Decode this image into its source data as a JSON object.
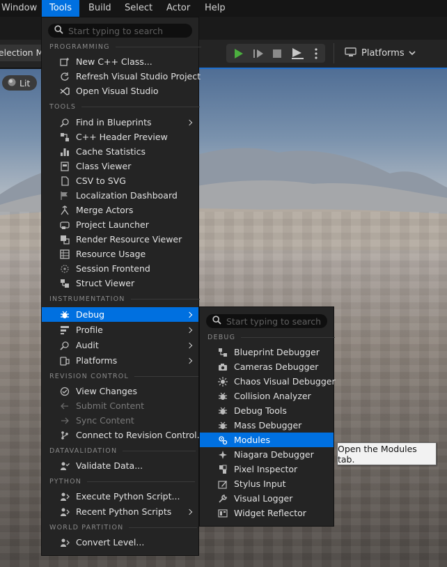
{
  "menubar": {
    "items": [
      {
        "label": "Window"
      },
      {
        "label": "Tools"
      },
      {
        "label": "Build"
      },
      {
        "label": "Select"
      },
      {
        "label": "Actor"
      },
      {
        "label": "Help"
      }
    ]
  },
  "toolbar": {
    "selection_mode": "Selection Mode",
    "platforms": "Platforms"
  },
  "viewport": {
    "lit": "Lit"
  },
  "tools_menu": {
    "search_placeholder": "Start typing to search",
    "sections": {
      "programming": "PROGRAMMING",
      "tools": "TOOLS",
      "instrumentation": "INSTRUMENTATION",
      "revision_control": "REVISION CONTROL",
      "datavalidation": "DATAVALIDATION",
      "python": "PYTHON",
      "world_partition": "WORLD PARTITION"
    },
    "items": {
      "new_cpp_class": "New C++ Class...",
      "refresh_vs": "Refresh Visual Studio Project",
      "open_vs": "Open Visual Studio",
      "find_in_blueprints": "Find in Blueprints",
      "cpp_header_preview": "C++ Header Preview",
      "cache_statistics": "Cache Statistics",
      "class_viewer": "Class Viewer",
      "csv_to_svg": "CSV to SVG",
      "localization_dashboard": "Localization Dashboard",
      "merge_actors": "Merge Actors",
      "project_launcher": "Project Launcher",
      "render_resource_viewer": "Render Resource Viewer",
      "resource_usage": "Resource Usage",
      "session_frontend": "Session Frontend",
      "struct_viewer": "Struct Viewer",
      "debug": "Debug",
      "profile": "Profile",
      "audit": "Audit",
      "platforms": "Platforms",
      "view_changes": "View Changes",
      "submit_content": "Submit Content",
      "sync_content": "Sync Content",
      "connect_revision_control": "Connect to Revision Control...",
      "validate_data": "Validate Data...",
      "execute_python_script": "Execute Python Script...",
      "recent_python_scripts": "Recent Python Scripts",
      "convert_level": "Convert Level..."
    }
  },
  "debug_menu": {
    "search_placeholder": "Start typing to search",
    "section": "DEBUG",
    "items": {
      "blueprint_debugger": "Blueprint Debugger",
      "cameras_debugger": "Cameras Debugger",
      "chaos_visual_debugger": "Chaos Visual Debugger",
      "collision_analyzer": "Collision Analyzer",
      "debug_tools": "Debug Tools",
      "mass_debugger": "Mass Debugger",
      "modules": "Modules",
      "niagara_debugger": "Niagara Debugger",
      "pixel_inspector": "Pixel Inspector",
      "stylus_input": "Stylus Input",
      "visual_logger": "Visual Logger",
      "widget_reflector": "Widget Reflector"
    }
  },
  "tooltip": {
    "text": "Open the Modules tab."
  },
  "colors": {
    "accent": "#0070e0",
    "menu_bg": "#242424",
    "play_green": "#4caf3f"
  }
}
